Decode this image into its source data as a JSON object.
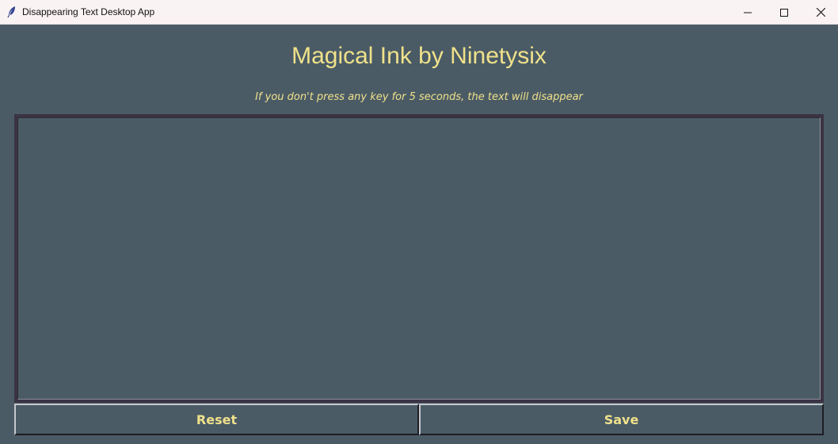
{
  "window": {
    "title": "Disappearing Text Desktop App",
    "icon": "feather-icon",
    "controls": [
      "minimize-icon",
      "maximize-icon",
      "close-icon"
    ]
  },
  "main": {
    "heading": "Magical Ink by Ninetysix",
    "subheading": "If you don't press any key for 5 seconds, the text will disappear",
    "editor_value": ""
  },
  "buttons": {
    "reset_label": "Reset",
    "save_label": "Save"
  },
  "colors": {
    "background": "#4a5b66",
    "accent_text": "#f0e18a",
    "editor_border": "#3b3344",
    "titlebar": "#faf3f3"
  }
}
